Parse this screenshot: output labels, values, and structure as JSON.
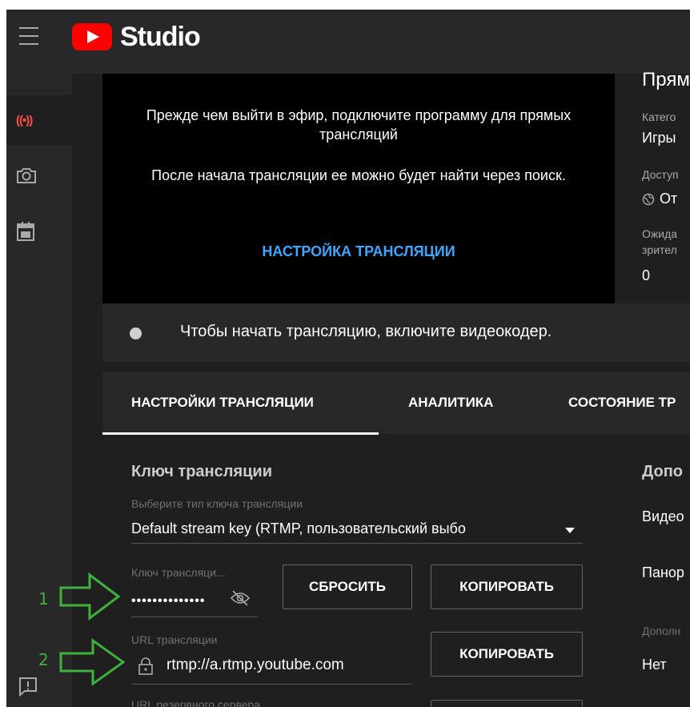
{
  "app": {
    "brand": "Studio",
    "colors": {
      "accent": "#3ea6ff",
      "brand_red": "#ff0000",
      "live_red": "#ff4e45",
      "annotation_green": "#3db23d"
    }
  },
  "sidebar": {
    "items": [
      {
        "icon": "live-icon",
        "label": "((•))",
        "active": true
      },
      {
        "icon": "camera-icon"
      },
      {
        "icon": "calendar-icon"
      }
    ],
    "feedback_icon": "feedback-icon"
  },
  "preview": {
    "line1": "Прежде чем выйти в эфир, подключите программу для прямых трансляций",
    "line2": "После начала трансляции ее можно будет найти через поиск.",
    "settings_link": "НАСТРОЙКА ТРАНСЛЯЦИИ"
  },
  "info": {
    "title": "Прям",
    "category_label": "Катего",
    "category_value": "Игры",
    "access_label": "Доступ",
    "access_value": "От",
    "waiting_label_1": "Ожида",
    "waiting_label_2": "зрител",
    "waiting_value": "0"
  },
  "status": {
    "text": "Чтобы начать трансляцию, включите видеокодер."
  },
  "tabs": [
    {
      "label": "НАСТРОЙКИ ТРАНСЛЯЦИИ",
      "active": true
    },
    {
      "label": "АНАЛИТИКА"
    },
    {
      "label": "СОСТОЯНИЕ ТР"
    }
  ],
  "stream_key": {
    "section_title": "Ключ трансляции",
    "type_label": "Выберите тип ключа трансляции",
    "type_value": "Default stream key (RTMP, пользовательский выбо",
    "key_label": "Ключ трансляци...",
    "key_value": "••••••••••••••",
    "reset_button": "СБРОСИТЬ",
    "copy_key_button": "КОПИРОВАТЬ",
    "url_label": "URL трансляции",
    "url_value": "rtmp://a.rtmp.youtube.com",
    "copy_url_button": "КОПИРОВАТЬ",
    "backup_label": "URL резервного сервера"
  },
  "additional": {
    "title": "Допо",
    "item1": "Видео",
    "item2": "Панор",
    "more_label": "Дополн",
    "more_value": "Нет"
  },
  "annotations": [
    {
      "number": "1"
    },
    {
      "number": "2"
    }
  ]
}
